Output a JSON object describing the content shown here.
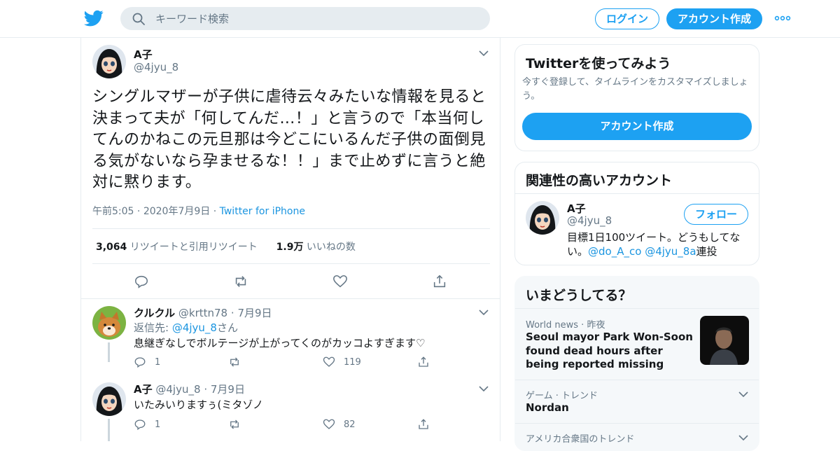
{
  "header": {
    "search_placeholder": "キーワード検索",
    "login_label": "ログイン",
    "signup_label": "アカウント作成"
  },
  "main_tweet": {
    "name": "A子",
    "handle": "@4jyu_8",
    "text": "シングルマザーが子供に虐待云々みたいな情報を見ると決まって夫が「何してんだ…！」と言うので「本当何してんのかねこの元旦那は今どこにいるんだ子供の面倒見る気がないなら孕ませるな！！」まで止めずに言うと絶対に黙ります。",
    "time": "午前5:05",
    "date": "2020年7月9日",
    "source": "Twitter for iPhone",
    "retweets": "3,064",
    "retweets_label": "リツイートと引用リツイート",
    "likes": "1.9万",
    "likes_label": "いいねの数"
  },
  "replies": [
    {
      "name": "クルクル",
      "handle": "@krttn78",
      "date": "7月9日",
      "reply_to_prefix": "返信先: ",
      "reply_to_handle": "@4jyu_8",
      "reply_to_suffix": "さん",
      "text": "息継ぎなしでボルテージが上がってくのがカッコよすぎます♡",
      "replies": "1",
      "likes": "119"
    },
    {
      "name": "A子",
      "handle": "@4jyu_8",
      "date": "7月9日",
      "text": "いたみいりますぅ(ミタゾノ",
      "replies": "1",
      "likes": "82"
    }
  ],
  "signup_card": {
    "title": "Twitterを使ってみよう",
    "desc": "今すぐ登録して、タイムラインをカスタマイズしましょう。",
    "button": "アカウント作成"
  },
  "related": {
    "title": "関連性の高いアカウント",
    "name": "A子",
    "handle": "@4jyu_8",
    "follow": "フォロー",
    "bio_prefix": "目標1日100ツイート。どうもしてない。",
    "bio_link1": "@do_A_co",
    "bio_link2": "@4jyu_8a",
    "bio_suffix": "連投"
  },
  "trends": {
    "title": "いまどうしてる？",
    "items": [
      {
        "category": "World news",
        "time": "昨夜",
        "title": "Seoul mayor Park Won-Soon found dead hours after being reported missing"
      },
      {
        "category": "ゲーム · トレンド",
        "title": "Nordan"
      },
      {
        "category": "アメリカ合衆国のトレンド"
      }
    ]
  },
  "colors": {
    "accent": "#1da1f2",
    "link": "#1b95e0",
    "border": "#e6ecf0",
    "muted": "#657786"
  }
}
